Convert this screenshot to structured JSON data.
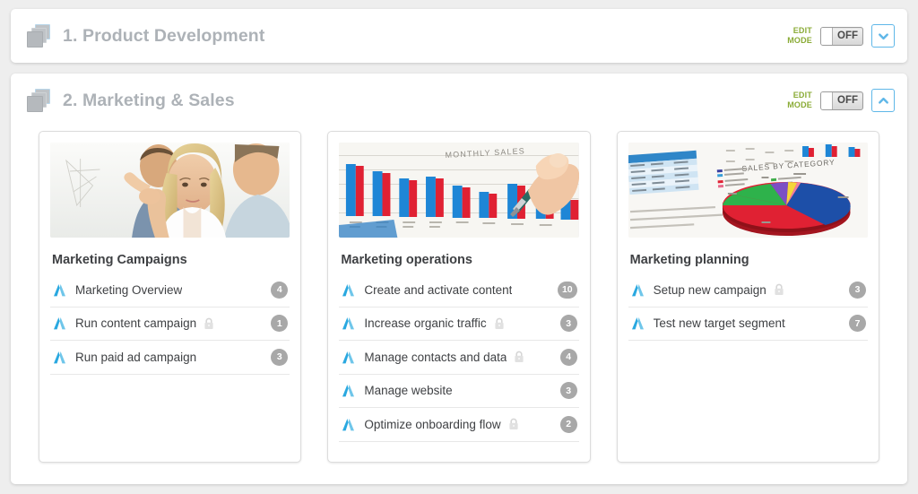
{
  "sections": [
    {
      "title": "1. Product Development",
      "icon": "layers-icon",
      "edit_mode_label_line1": "EDIT",
      "edit_mode_label_line2": "MODE",
      "toggle_state": "OFF",
      "expand_icon": "chevron-down-icon",
      "expanded": false
    },
    {
      "title": "2. Marketing & Sales",
      "icon": "layers-icon",
      "edit_mode_label_line1": "EDIT",
      "edit_mode_label_line2": "MODE",
      "toggle_state": "OFF",
      "expand_icon": "chevron-up-icon",
      "expanded": true
    }
  ],
  "cards": [
    {
      "title": "Marketing Campaigns",
      "image": "business-team-whiteboard-photo",
      "tasks": [
        {
          "label": "Marketing Overview",
          "locked": false,
          "count": "4"
        },
        {
          "label": "Run content campaign",
          "locked": true,
          "count": "1"
        },
        {
          "label": "Run paid ad campaign",
          "locked": false,
          "count": "3"
        }
      ]
    },
    {
      "title": "Marketing operations",
      "image": "monthly-sales-bar-chart-photo",
      "image_caption": "MONTHLY SALES",
      "tasks": [
        {
          "label": "Create and activate content",
          "locked": false,
          "count": "10"
        },
        {
          "label": "Increase organic traffic",
          "locked": true,
          "count": "3"
        },
        {
          "label": "Manage contacts and data",
          "locked": true,
          "count": "4"
        },
        {
          "label": "Manage website",
          "locked": false,
          "count": "3"
        },
        {
          "label": "Optimize onboarding flow",
          "locked": true,
          "count": "2"
        }
      ]
    },
    {
      "title": "Marketing planning",
      "image": "sales-by-category-pie-chart-photo",
      "image_caption": "SALES BY CATEGORY",
      "tasks": [
        {
          "label": "Setup new campaign",
          "locked": true,
          "count": "3"
        },
        {
          "label": "Test new target segment",
          "locked": false,
          "count": "7"
        }
      ]
    }
  ],
  "colors": {
    "page_background": "#eeeeee",
    "panel_background": "#ffffff",
    "section_title": "#adb2b7",
    "card_title": "#3f4144",
    "task_label": "#3f4144",
    "badge_background": "#a8a8a8",
    "road_icon_blue": "#29a8e0",
    "edit_mode_green": "#8aab36",
    "chevron_blue": "#5fb7e8"
  }
}
